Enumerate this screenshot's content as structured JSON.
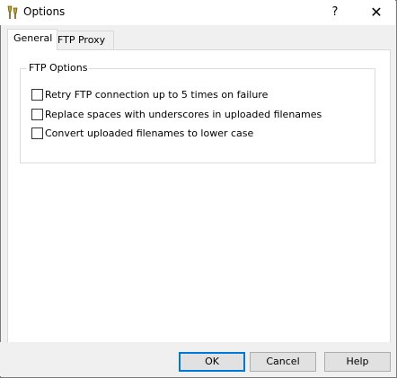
{
  "window": {
    "title": "Options",
    "help_symbol": "?",
    "close_symbol": "✕"
  },
  "tabs": [
    {
      "label": "General",
      "active": true
    },
    {
      "label": "FTP Proxy",
      "active": false
    }
  ],
  "group": {
    "title": "FTP Options",
    "options": [
      {
        "label": "Retry FTP connection up to 5 times on failure",
        "checked": false
      },
      {
        "label": "Replace spaces with underscores in uploaded filenames",
        "checked": false
      },
      {
        "label": "Convert uploaded filenames to lower case",
        "checked": false
      }
    ]
  },
  "buttons": {
    "ok": "OK",
    "cancel": "Cancel",
    "help": "Help"
  },
  "colors": {
    "focus_border": "#0078d7",
    "dialog_bg": "#f0f0f0"
  },
  "icons": {
    "app_icon": "options-app-icon"
  }
}
